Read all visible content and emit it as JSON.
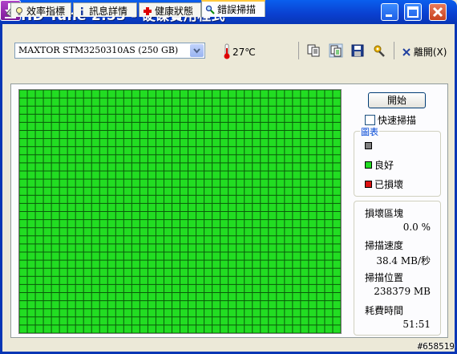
{
  "window": {
    "title": "HD Tune 2.53 - 硬碟實用程式",
    "colors": {
      "titlebar": "#0A3FCF",
      "close": "#C8421E",
      "grid_ok": "#22DD22",
      "grid_line": "#0A5A0A"
    }
  },
  "toolbar": {
    "drive": "MAXTOR STM3250310AS (250 GB)",
    "temperature": "27℃",
    "exit_label": "離開(X)",
    "icons": [
      "copy-icon",
      "copy-all-icon",
      "save-icon",
      "options-icon",
      "exit-icon"
    ]
  },
  "tabs": [
    {
      "label": "效率指標",
      "icon": "lightbulb-icon"
    },
    {
      "label": "訊息詳情",
      "icon": "info-icon"
    },
    {
      "label": "健康狀態",
      "icon": "health-cross-icon"
    },
    {
      "label": "錯誤掃描",
      "icon": "magnifier-icon",
      "active": true
    }
  ],
  "scan": {
    "start_label": "開始",
    "quick_scan_label": "快速掃描",
    "quick_scan_checked": false,
    "legend_title": "圖表",
    "legend": [
      {
        "label": "",
        "color": "#808080"
      },
      {
        "label": "良好",
        "color": "#22DD22"
      },
      {
        "label": "已損壞",
        "color": "#DD1111"
      }
    ],
    "grid": {
      "columns": 40,
      "rows": 30
    }
  },
  "stats": {
    "damaged_label": "損壞區塊",
    "damaged_value": "0.0 %",
    "speed_label": "掃描速度",
    "speed_value": "38.4 MB/秒",
    "position_label": "掃描位置",
    "position_value": "238379 MB",
    "elapsed_label": "耗費時間",
    "elapsed_value": "51:51"
  },
  "watermark": "#658519"
}
